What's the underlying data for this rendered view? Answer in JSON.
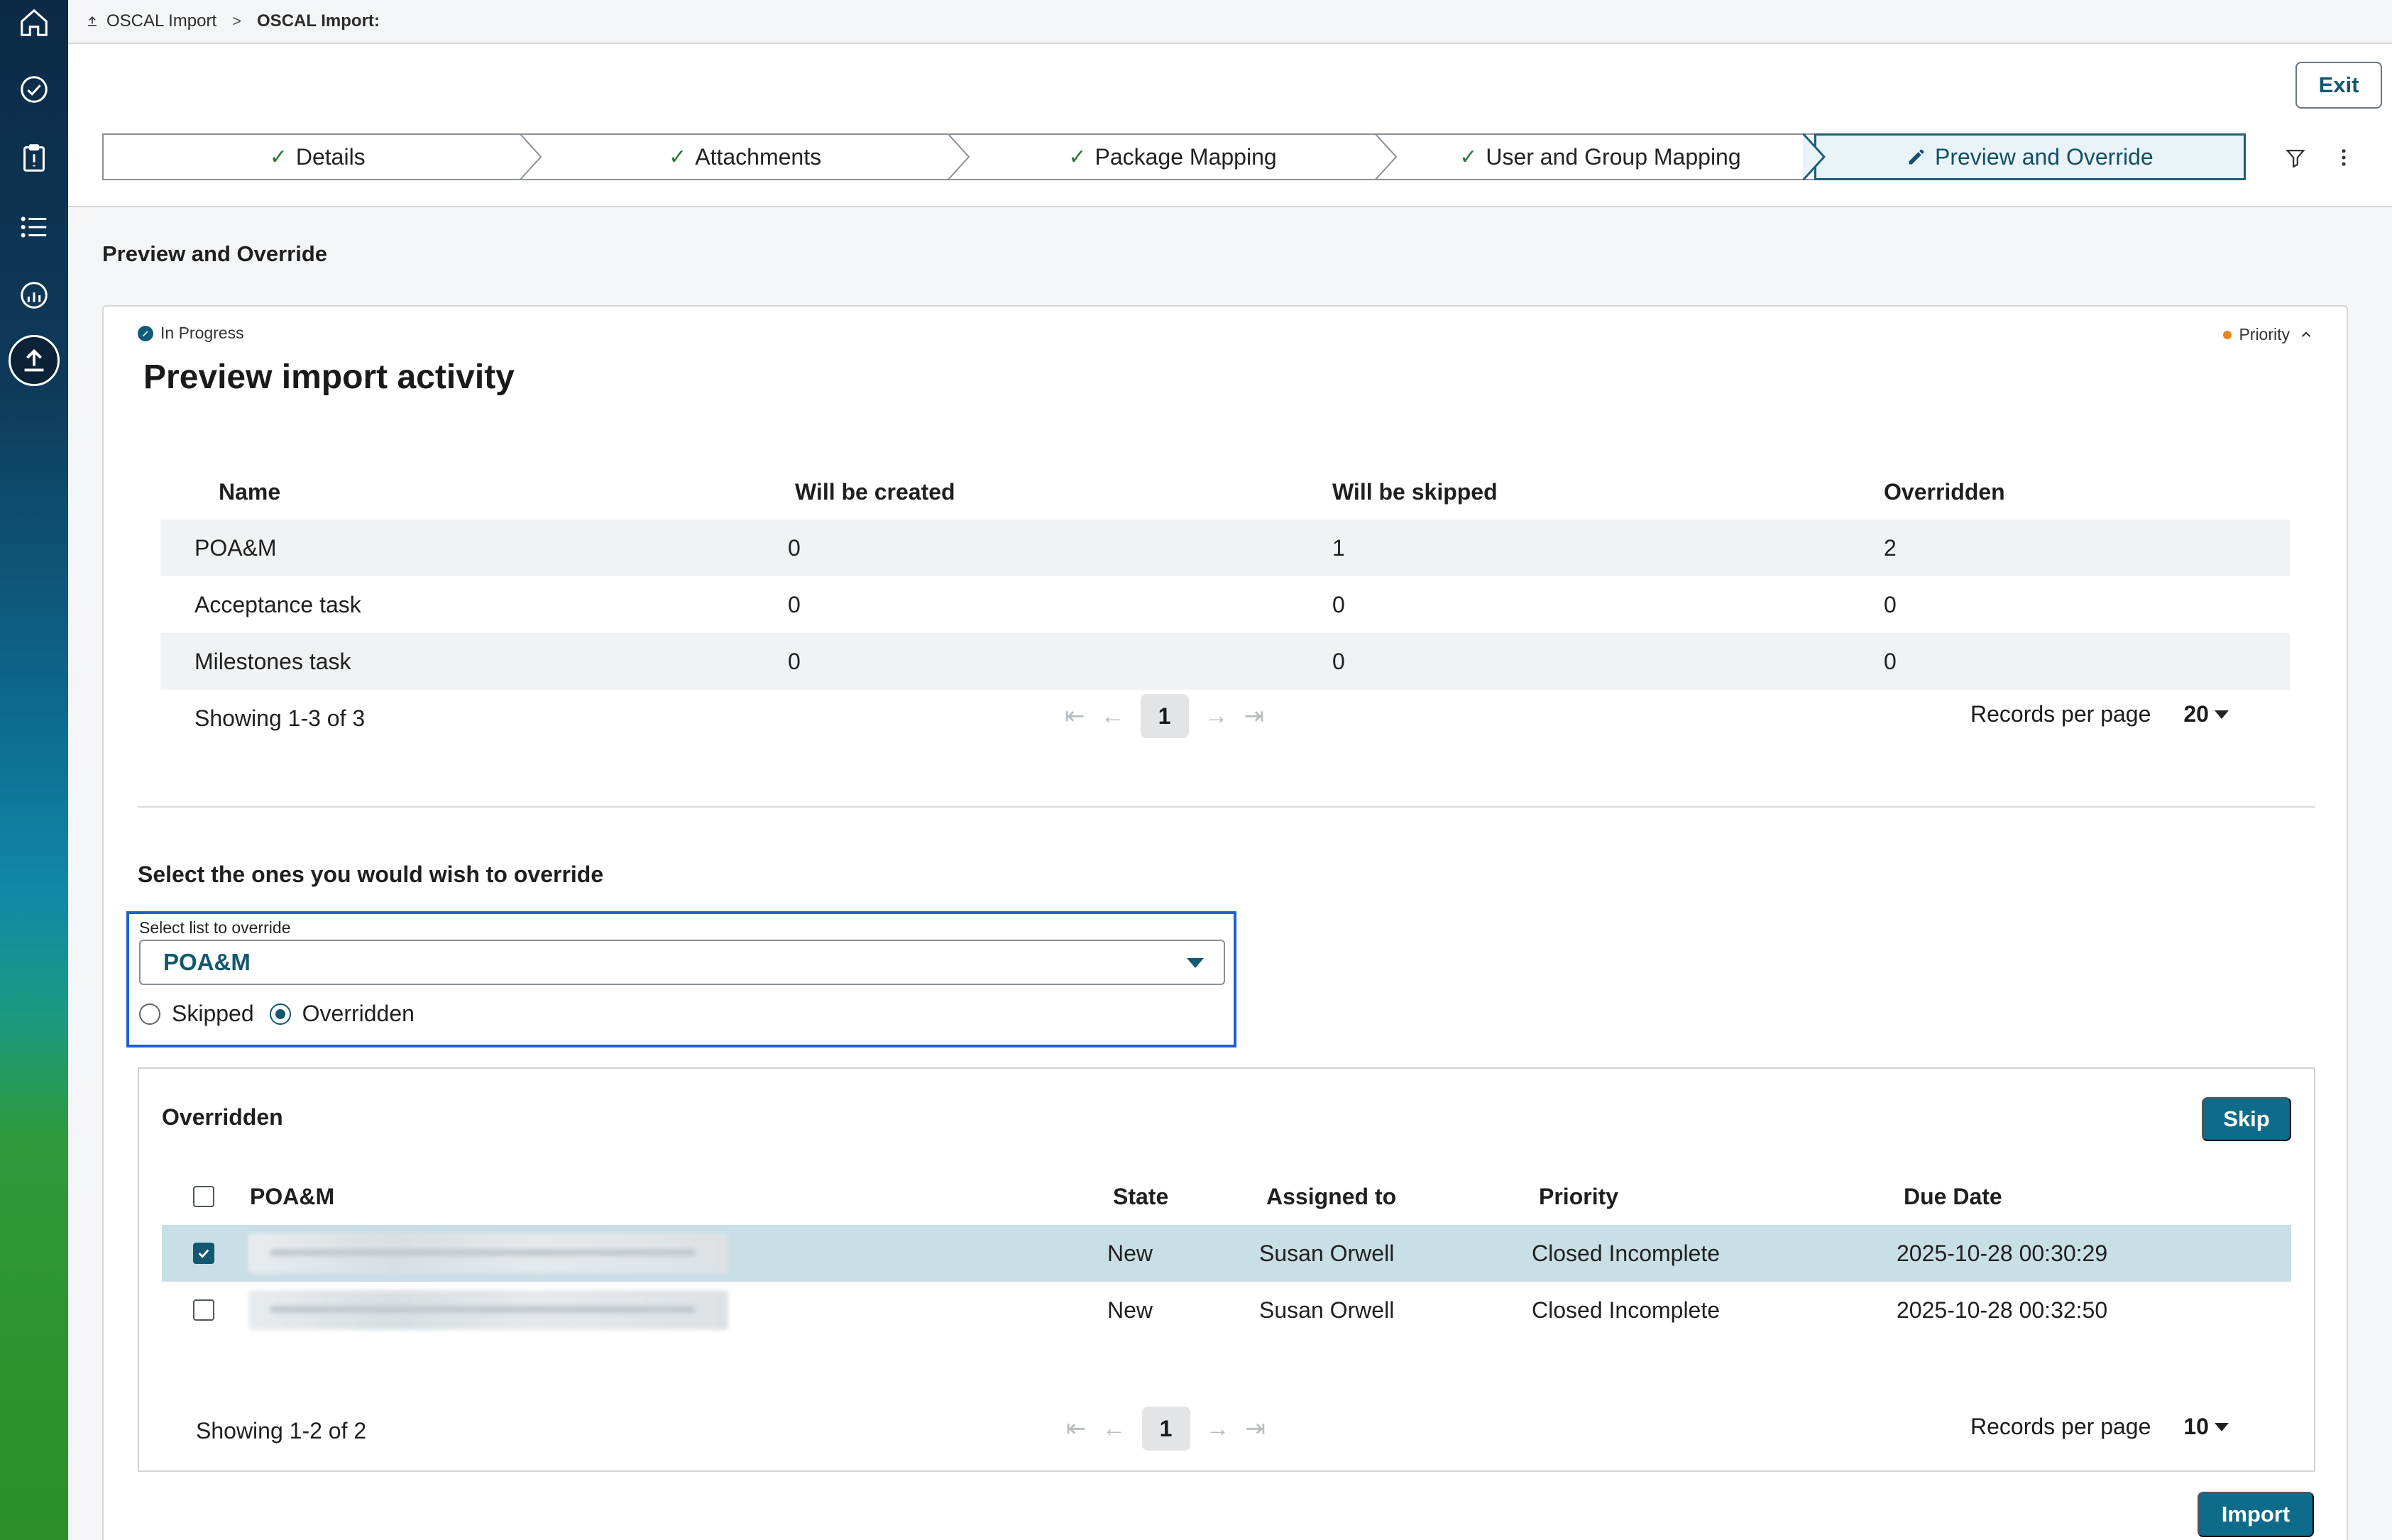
{
  "breadcrumb": {
    "items": [
      {
        "label": "OSCAL Import",
        "icon": "upload-icon"
      },
      {
        "label": "OSCAL Import:"
      }
    ],
    "separator": ">"
  },
  "header": {
    "exit_label": "Exit",
    "steps": [
      {
        "label": "Details",
        "state": "done"
      },
      {
        "label": "Attachments",
        "state": "done"
      },
      {
        "label": "Package Mapping",
        "state": "done"
      },
      {
        "label": "User and Group Mapping",
        "state": "done"
      },
      {
        "label": "Preview and Override",
        "state": "active"
      }
    ],
    "check_glyph": "✓"
  },
  "page": {
    "title": "Preview and Override"
  },
  "card": {
    "status": "In Progress",
    "priority": "Priority",
    "title": "Preview import activity",
    "summary_table": {
      "columns": [
        "Name",
        "Will be created",
        "Will be skipped",
        "Overridden"
      ],
      "rows": [
        [
          "POA&M",
          "0",
          "1",
          "2"
        ],
        [
          "Acceptance task",
          "0",
          "0",
          "0"
        ],
        [
          "Milestones task",
          "0",
          "0",
          "0"
        ]
      ],
      "showing": "Showing 1-3 of 3",
      "page": "1",
      "records_label": "Records per page",
      "records_value": "20"
    },
    "override_heading": "Select the ones you would wish to override",
    "select": {
      "label": "Select list to override",
      "value": "POA&M"
    },
    "radios": [
      {
        "label": "Skipped",
        "checked": false
      },
      {
        "label": "Overridden",
        "checked": true
      }
    ],
    "overridden_panel": {
      "title": "Overridden",
      "skip_label": "Skip",
      "columns": [
        "POA&M",
        "State",
        "Assigned to",
        "Priority",
        "Due Date"
      ],
      "rows": [
        {
          "state": "New",
          "assigned": "Susan Orwell",
          "priority": "Closed Incomplete",
          "due": "2025-10-28 00:30:29",
          "checked": true
        },
        {
          "state": "New",
          "assigned": "Susan Orwell",
          "priority": "Closed Incomplete",
          "due": "2025-10-28 00:32:50",
          "checked": false
        }
      ],
      "showing": "Showing 1-2 of 2",
      "page": "1",
      "records_label": "Records per page",
      "records_value": "10"
    },
    "import_label": "Import"
  },
  "colors": {
    "accent": "#12586e",
    "primary_button": "#0f6b8a",
    "focus_outline": "#1f5fd6",
    "priority_dot": "#e6881f",
    "selected_row": "#c9dfe6"
  }
}
